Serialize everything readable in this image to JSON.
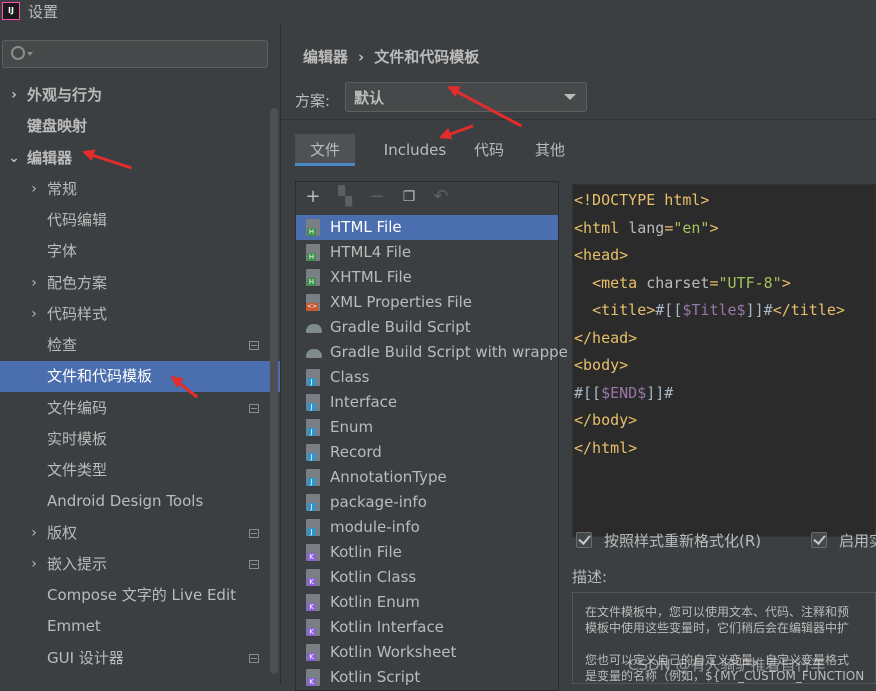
{
  "window": {
    "title": "设置",
    "app_icon": "IJ"
  },
  "search": {
    "placeholder": "",
    "icon": "search-icon"
  },
  "sidebar": {
    "items": [
      {
        "label": "外观与行为",
        "expandable": true,
        "expanded": false,
        "bold": true
      },
      {
        "label": "键盘映射",
        "bold": true
      },
      {
        "label": "编辑器",
        "expandable": true,
        "expanded": true,
        "bold": true
      },
      {
        "label": "常规",
        "expandable": true
      },
      {
        "label": "代码编辑"
      },
      {
        "label": "字体"
      },
      {
        "label": "配色方案",
        "expandable": true
      },
      {
        "label": "代码样式",
        "expandable": true
      },
      {
        "label": "检查",
        "project_icon": true
      },
      {
        "label": "文件和代码模板",
        "selected": true
      },
      {
        "label": "文件编码",
        "project_icon": true
      },
      {
        "label": "实时模板"
      },
      {
        "label": "文件类型"
      },
      {
        "label": "Android Design Tools"
      },
      {
        "label": "版权",
        "expandable": true,
        "project_icon": true
      },
      {
        "label": "嵌入提示",
        "expandable": true,
        "project_icon": true
      },
      {
        "label": "Compose 文字的 Live Edit"
      },
      {
        "label": "Emmet"
      },
      {
        "label": "GUI 设计器",
        "project_icon": true
      }
    ]
  },
  "breadcrumb": {
    "parent": "编辑器",
    "separator": "›",
    "current": "文件和代码模板"
  },
  "scheme": {
    "label": "方案:",
    "value": "默认"
  },
  "tabs": [
    "文件",
    "Includes",
    "代码",
    "其他"
  ],
  "active_tab": "文件",
  "toolbar": [
    "add-icon",
    "copy-template-icon",
    "remove-icon",
    "duplicate-icon",
    "reset-icon"
  ],
  "templates": [
    {
      "name": "HTML File",
      "icon": "html",
      "selected": true
    },
    {
      "name": "HTML4 File",
      "icon": "html"
    },
    {
      "name": "XHTML File",
      "icon": "html"
    },
    {
      "name": "XML Properties File",
      "icon": "xml"
    },
    {
      "name": "Gradle Build Script",
      "icon": "gradle"
    },
    {
      "name": "Gradle Build Script with wrappe",
      "icon": "gradle"
    },
    {
      "name": "Class",
      "icon": "java"
    },
    {
      "name": "Interface",
      "icon": "java"
    },
    {
      "name": "Enum",
      "icon": "java"
    },
    {
      "name": "Record",
      "icon": "java"
    },
    {
      "name": "AnnotationType",
      "icon": "java"
    },
    {
      "name": "package-info",
      "icon": "java"
    },
    {
      "name": "module-info",
      "icon": "java"
    },
    {
      "name": "Kotlin File",
      "icon": "kt"
    },
    {
      "name": "Kotlin Class",
      "icon": "kt"
    },
    {
      "name": "Kotlin Enum",
      "icon": "kt"
    },
    {
      "name": "Kotlin Interface",
      "icon": "kt"
    },
    {
      "name": "Kotlin Worksheet",
      "icon": "kt"
    },
    {
      "name": "Kotlin Script",
      "icon": "kt"
    }
  ],
  "code": [
    [
      [
        "tag",
        "<!DOCTYPE html>"
      ]
    ],
    [
      [
        "tag",
        "<html "
      ],
      [
        "attr",
        "lang"
      ],
      [
        "tag",
        "="
      ],
      [
        "str",
        "\"en\""
      ],
      [
        "tag",
        ">"
      ]
    ],
    [
      [
        "tag",
        "<head>"
      ]
    ],
    [
      [
        "plain",
        "  "
      ],
      [
        "tag",
        "<meta "
      ],
      [
        "attr",
        "charset"
      ],
      [
        "tag",
        "="
      ],
      [
        "str",
        "\"UTF-8\""
      ],
      [
        "tag",
        ">"
      ]
    ],
    [
      [
        "plain",
        "  "
      ],
      [
        "tag",
        "<title>"
      ],
      [
        "plain",
        "#[["
      ],
      [
        "var",
        "$Title$"
      ],
      [
        "plain",
        "]]#"
      ],
      [
        "tag",
        "</title>"
      ]
    ],
    [
      [
        "tag",
        "</head>"
      ]
    ],
    [
      [
        "tag",
        "<body>"
      ]
    ],
    [
      [
        "plain",
        "#[["
      ],
      [
        "var",
        "$END$"
      ],
      [
        "plain",
        "]]#"
      ]
    ],
    [
      [
        "tag",
        "</body>"
      ]
    ],
    [
      [
        "tag",
        "</html>"
      ]
    ]
  ],
  "options": {
    "reformat": "按照样式重新格式化(R)",
    "enable": "启用实"
  },
  "description": {
    "label": "描述:",
    "lines": [
      "在文件模板中，您可以使用文本、代码、注释和预",
      "模板中使用这些变量时，它们稍后会在编辑器中扩",
      "",
      "您也可以定义自己的自定义变量。自定义变量格式",
      "是变量的名称（例如，${MY_CUSTOM_FUNCTION"
    ]
  },
  "watermark": "CSDN @有人骑驴推着自行车"
}
